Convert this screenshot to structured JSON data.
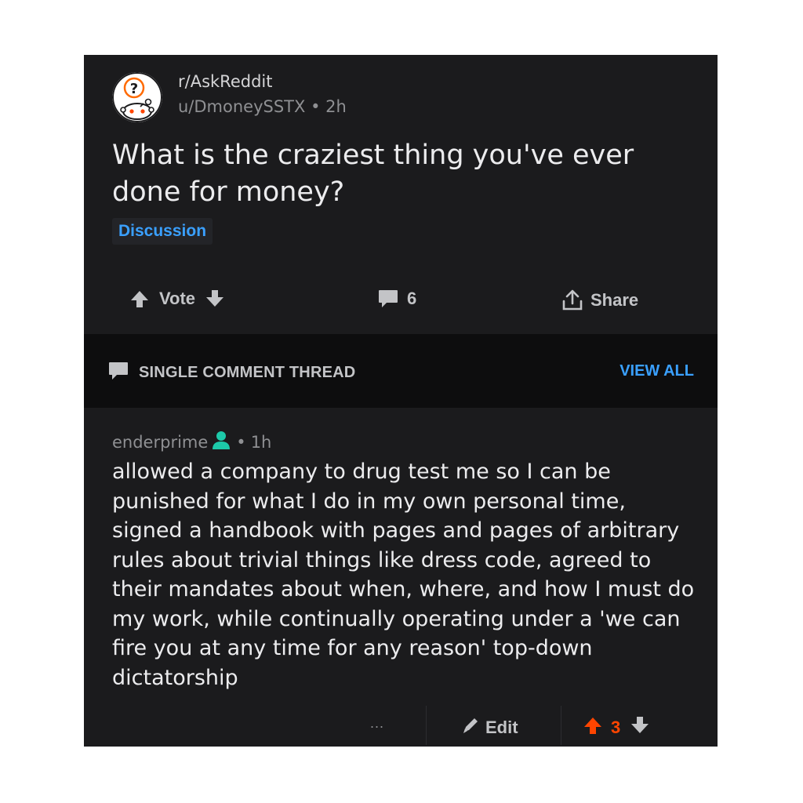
{
  "post": {
    "subreddit": "r/AskReddit",
    "author": "u/DmoneySSTX",
    "separator": "•",
    "age": "2h",
    "title": "What is the craziest thing you've ever done for money?",
    "flair": "Discussion"
  },
  "actions": {
    "vote_label": "Vote",
    "comment_count": "6",
    "share_label": "Share"
  },
  "thread_bar": {
    "label": "SINGLE COMMENT THREAD",
    "view_all": "VIEW ALL"
  },
  "comment": {
    "author": "enderprime",
    "separator": "•",
    "age": "1h",
    "body": "allowed a company to drug test me so I can be punished for what I do in my own personal time, signed a handbook with pages and pages of arbitrary rules about trivial things like dress code, agreed to their mandates about when, where, and how I must do my work, while continually operating under a 'we can fire you at any time for any reason' top-down dictatorship",
    "more_label": "...",
    "edit_label": "Edit",
    "score": "3"
  },
  "colors": {
    "background": "#1b1b1d",
    "thread_bar": "#0d0d0e",
    "accent_blue": "#3aa0ff",
    "upvote_orange": "#ff4500",
    "op_icon_teal": "#1dc9a9"
  },
  "icons": {
    "subreddit_avatar": "askreddit-snoo-icon",
    "upvote": "arrow-up-icon",
    "downvote": "arrow-down-icon",
    "comments": "comment-bubble-icon",
    "share": "share-icon",
    "thread": "comment-bubble-icon",
    "op": "person-icon",
    "edit": "pencil-icon"
  }
}
